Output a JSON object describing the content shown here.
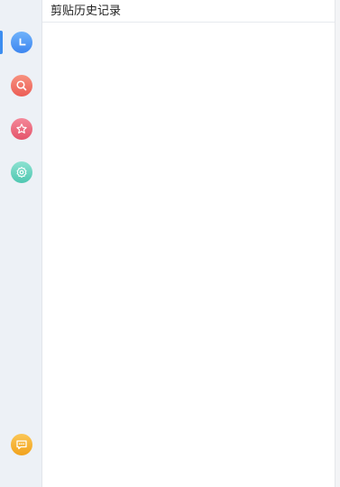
{
  "header": {
    "title": "剪贴历史记录"
  },
  "sidebar": {
    "items": [
      {
        "name": "history",
        "icon": "clock-icon",
        "color": "#3d86f0",
        "active": true
      },
      {
        "name": "search",
        "icon": "search-icon",
        "color": "#ec5d55",
        "active": false
      },
      {
        "name": "favorites",
        "icon": "star-icon",
        "color": "#e4546a",
        "active": false
      },
      {
        "name": "settings",
        "icon": "gear-icon",
        "color": "#4fc7b1",
        "active": false
      },
      {
        "name": "feedback",
        "icon": "chat-bubble-icon",
        "color": "#f1a21c",
        "active": false
      }
    ]
  },
  "colors": {
    "sidebar_bg": "#edf1f6",
    "accent": "#3d8ef0"
  }
}
